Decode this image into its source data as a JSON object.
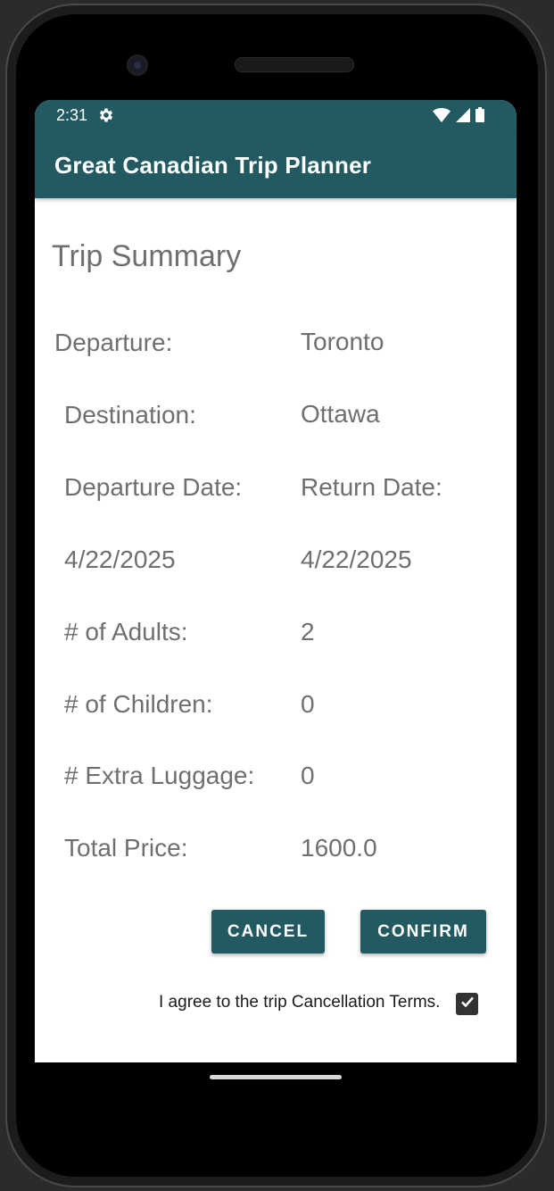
{
  "status_bar": {
    "time": "2:31",
    "icons": [
      "settings-gear-icon",
      "wifi-icon",
      "cellular-signal-icon",
      "battery-icon"
    ]
  },
  "app_bar": {
    "title": "Great Canadian Trip Planner",
    "color": "#235a61"
  },
  "summary": {
    "title": "Trip Summary",
    "departure_label": "Departure:",
    "departure_value": "Toronto",
    "destination_label": "Destination:",
    "destination_value": "Ottawa",
    "departure_date_label": "Departure Date:",
    "return_date_label": "Return Date:",
    "departure_date_value": "4/22/2025",
    "return_date_value": "4/22/2025",
    "adults_label": "# of Adults:",
    "adults_value": "2",
    "children_label": "# of Children:",
    "children_value": "0",
    "luggage_label": "# Extra Luggage:",
    "luggage_value": "0",
    "total_price_label": "Total Price:",
    "total_price_value": "1600.0"
  },
  "actions": {
    "cancel_label": "CANCEL",
    "confirm_label": "CONFIRM"
  },
  "agreement": {
    "text": "I agree to the trip Cancellation Terms.",
    "checked": true
  }
}
